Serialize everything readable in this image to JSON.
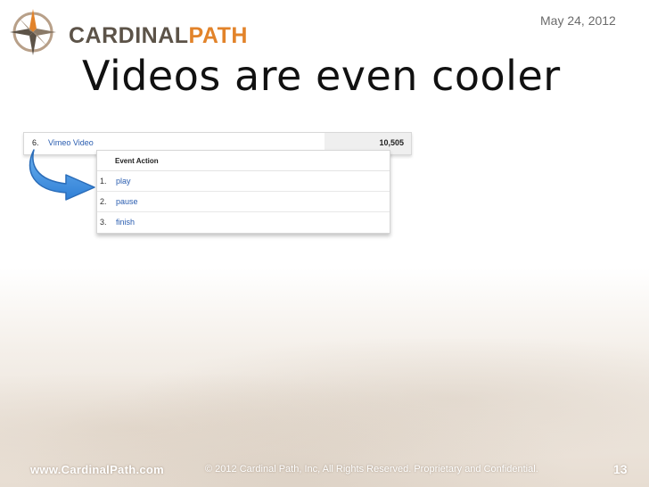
{
  "header": {
    "logo_part1": "CARDINAL",
    "logo_part2": "PATH",
    "date": "May 24, 2012",
    "title": "Videos are even cooler"
  },
  "report": {
    "main_row": {
      "rank": "6.",
      "label": "Vimeo Video",
      "value": "10,505"
    },
    "sub_header": "Event Action",
    "sub_rows": [
      {
        "rank": "1.",
        "label": "play"
      },
      {
        "rank": "2.",
        "label": "pause"
      },
      {
        "rank": "3.",
        "label": "finish"
      }
    ]
  },
  "footer": {
    "url": "www.CardinalPath.com",
    "copyright": "© 2012 Cardinal Path, Inc, All Rights Reserved. Proprietary and Confidential.",
    "page": "13"
  },
  "colors": {
    "brand_orange": "#e2832a",
    "brand_brown": "#5c5348",
    "link_blue": "#2a5db0",
    "arrow_blue": "#3d8ee0"
  },
  "icons": {
    "logo": "compass-icon",
    "arrow": "curved-arrow-icon"
  }
}
